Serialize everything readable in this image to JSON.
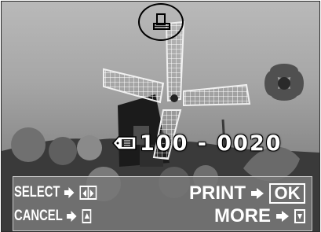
{
  "print_marker": {
    "icon": "print-icon"
  },
  "frame_number": {
    "icon": "file-number-icon",
    "text": "100 - 0020"
  },
  "menu": {
    "select_label": "SELECT",
    "cancel_label": "CANCEL",
    "print_label": "PRINT",
    "ok_label": "OK",
    "more_label": "MORE"
  }
}
